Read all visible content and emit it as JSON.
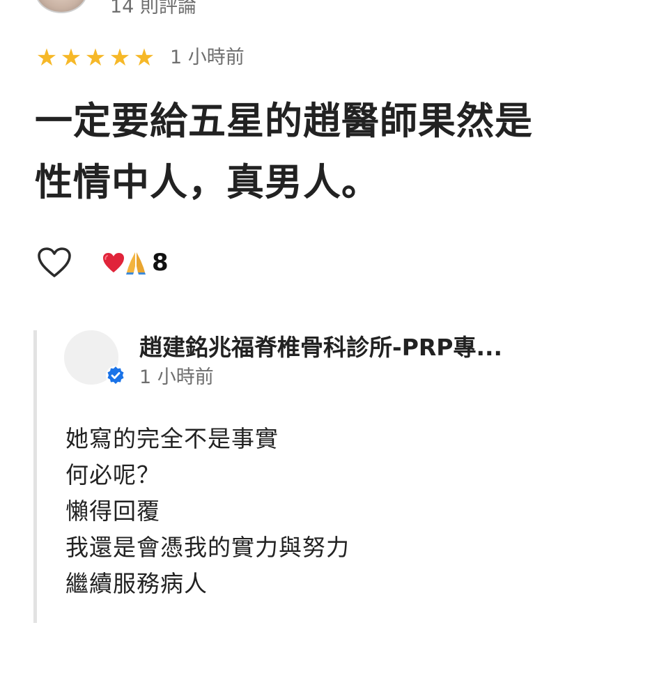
{
  "header": {
    "review_count": "14 則評論"
  },
  "review": {
    "stars": 5,
    "star_color": "#f6b828",
    "time": "1 小時前",
    "text": "一定要給五星的趙醫師果然是\n性情中人，真男人。"
  },
  "actions": {
    "like_icon": "heart-outline-icon",
    "reaction_emojis": [
      "red-heart-emoji",
      "folded-hands-emoji"
    ],
    "reaction_count": "8"
  },
  "reply": {
    "author": "趙建銘兆福脊椎骨科診所-PRP專...",
    "verified_icon": "verified-badge-icon",
    "verified_color": "#1a73e8",
    "time": "1 小時前",
    "lines": [
      "她寫的完全不是事實",
      "何必呢？",
      "懶得回覆",
      "我還是會憑我的實力與努力",
      "繼續服務病人"
    ]
  }
}
